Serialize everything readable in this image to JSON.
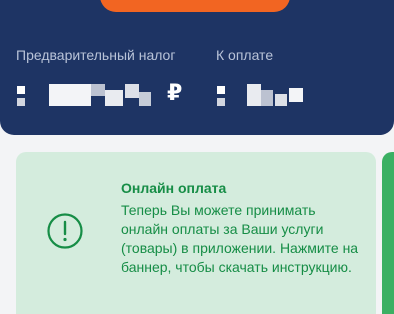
{
  "header": {
    "prelim_tax_label": "Предварительный налог",
    "to_pay_label": "К оплате",
    "currency_symbol": "₽"
  },
  "banner": {
    "title": "Онлайн оплата",
    "text": "Теперь Вы можете принимать онлайн оплаты за Ваши услуги (товары) в приложении. Нажмите на баннер, чтобы скачать инструкцию."
  },
  "colors": {
    "header_bg": "#1e3464",
    "accent_orange": "#f26522",
    "banner_bg": "#d4ecdd",
    "banner_text": "#168d46",
    "banner_side": "#3bb063"
  },
  "icons": {
    "banner_icon": "alert-circle-icon"
  }
}
